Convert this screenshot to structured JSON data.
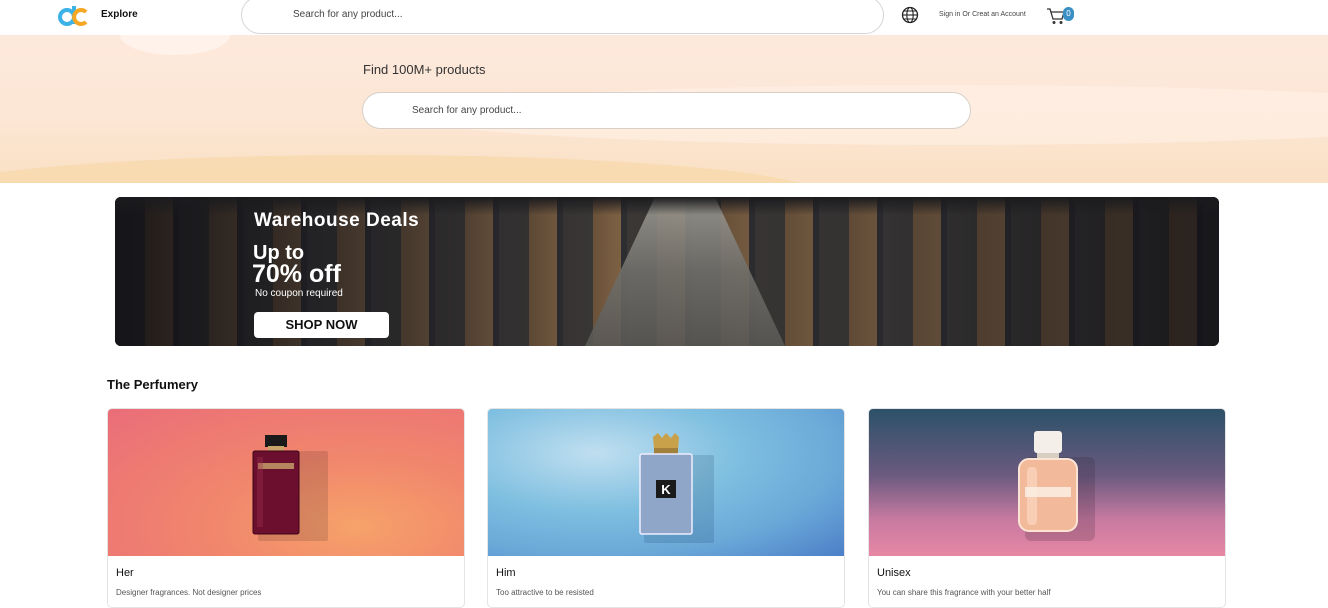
{
  "header": {
    "logo_text": "dc",
    "explore_label": "Explore",
    "search_placeholder": "Search for any product...",
    "signin_label": "Sign in Or Creat an Account",
    "cart_count": "0"
  },
  "hero": {
    "title": "Find 100M+ products",
    "search_placeholder": "Search for any product..."
  },
  "banner": {
    "title": "Warehouse Deals",
    "line1": "Up to",
    "line2": "70% off",
    "subtitle": "No coupon required",
    "cta": "SHOP NOW"
  },
  "perfumery": {
    "title": "The Perfumery",
    "cards": [
      {
        "name": "Her",
        "description": "Designer fragrances. Not designer prices",
        "icon": "perfume-bottle-dark-red"
      },
      {
        "name": "Him",
        "description": "Too attractive to be resisted",
        "icon": "perfume-bottle-blue-crown"
      },
      {
        "name": "Unisex",
        "description": "You can share this fragrance with your better half",
        "icon": "perfume-bottle-peach"
      }
    ]
  },
  "colors": {
    "accent": "#3a8fc4",
    "hero_bg": "#fce6d5"
  }
}
